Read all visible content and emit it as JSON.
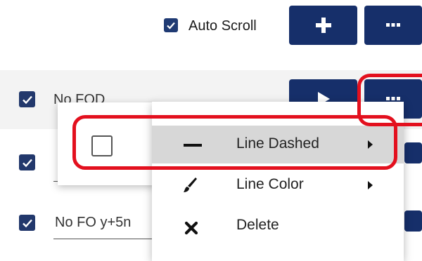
{
  "toolbar": {
    "auto_scroll_label": "Auto Scroll",
    "auto_scroll_checked": true,
    "add_icon": "plus-icon",
    "more_icon": "ellipsis-icon"
  },
  "rows": [
    {
      "label": "No FOD",
      "checked": true,
      "play_icon": "play-icon",
      "more_icon": "ellipsis-icon"
    },
    {
      "label": "",
      "checked": true
    },
    {
      "label": "No FO y+5n",
      "checked": true
    }
  ],
  "submenu": {
    "checkbox_checked": false
  },
  "context_menu": {
    "items": [
      {
        "label": "Line Dashed",
        "icon": "dash-icon",
        "has_submenu": true,
        "highlighted": true
      },
      {
        "label": "Line Color",
        "icon": "brush-icon",
        "has_submenu": true,
        "highlighted": false
      },
      {
        "label": "Delete",
        "icon": "close-icon",
        "has_submenu": false,
        "highlighted": false
      }
    ]
  },
  "colors": {
    "navy": "#162f6a",
    "checkbox": "#22386c",
    "highlight": "#d7d7d7",
    "annotation_red": "#e3101e"
  }
}
